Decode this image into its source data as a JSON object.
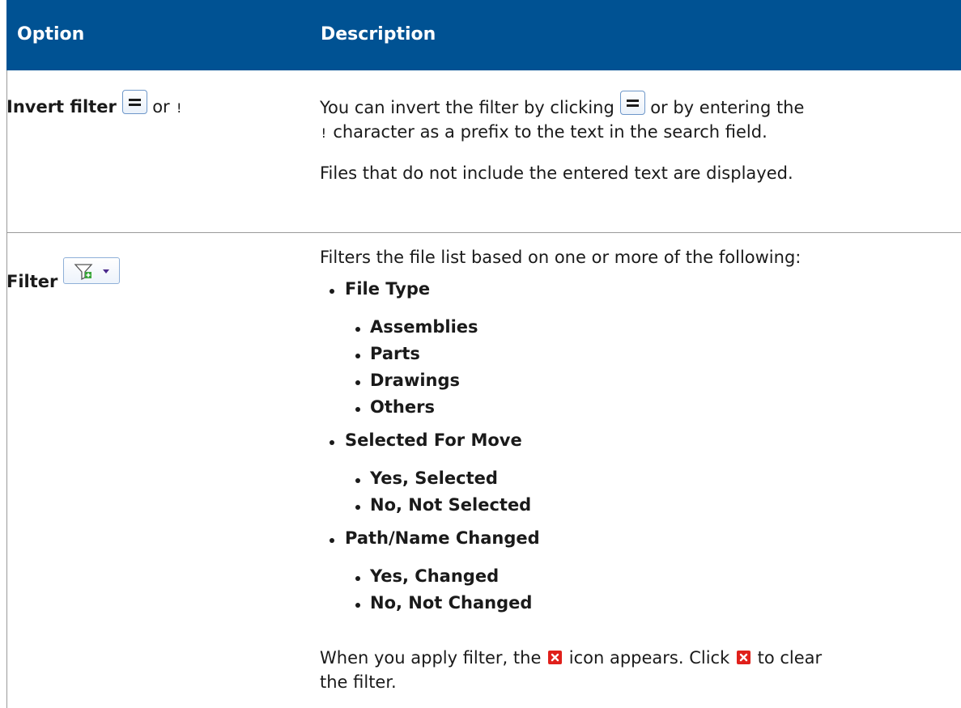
{
  "header": {
    "option": "Option",
    "description": "Description"
  },
  "rows": [
    {
      "option_label": "Invert filter",
      "option_connector": "or",
      "option_char": "!",
      "desc_line1_pre": "You can invert the filter by clicking",
      "desc_line1_post": "or by entering the",
      "desc_line2_char": "!",
      "desc_line2_text": "character as a prefix to the text in the search field.",
      "desc_para2": "Files that do not include the entered text are displayed."
    },
    {
      "option_label": "Filter",
      "intro": "Filters the file list based on one or more of the following:",
      "groups": [
        {
          "label": "File Type",
          "items": [
            "Assemblies",
            "Parts",
            "Drawings",
            "Others"
          ]
        },
        {
          "label": "Selected For Move",
          "items": [
            "Yes, Selected",
            "No, Not Selected"
          ]
        },
        {
          "label": "Path/Name Changed",
          "items": [
            "Yes, Changed",
            "No, Not Changed"
          ]
        }
      ],
      "footer_1": "When you apply filter, the",
      "footer_2": "icon appears. Click",
      "footer_3": "to clear",
      "footer_4": "the filter."
    }
  ],
  "icons": {
    "invert": "equals-icon",
    "filter": "filter-add-icon",
    "clear": "clear-filter-icon"
  },
  "colors": {
    "header_bg": "#005293",
    "header_text": "#ffffff",
    "clear_icon": "#e0201b"
  }
}
